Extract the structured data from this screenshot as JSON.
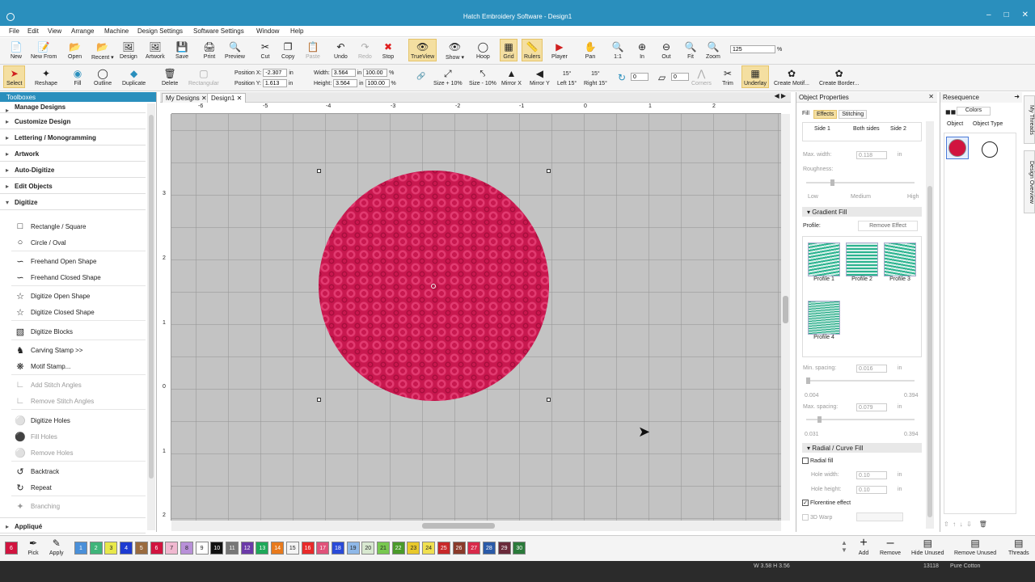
{
  "app_title": "Hatch Embroidery Software - Design1",
  "menu": [
    "File",
    "Edit",
    "View",
    "Arrange",
    "Machine",
    "Design Settings",
    "Software Settings",
    "Window",
    "Help"
  ],
  "toolbar1": [
    {
      "label": "New",
      "icon": "new-icon"
    },
    {
      "label": "New From",
      "icon": "new-from-icon"
    },
    {
      "label": "Open",
      "icon": "open-icon"
    },
    {
      "label": "Recent ▾",
      "icon": "recent-icon"
    },
    {
      "label": "Design",
      "icon": "design-icon"
    },
    {
      "label": "Artwork",
      "icon": "artwork-icon"
    },
    {
      "label": "Save",
      "icon": "save-icon"
    },
    {
      "label": "Print",
      "icon": "print-icon"
    },
    {
      "label": "Preview",
      "icon": "preview-icon"
    },
    {
      "label": "Cut",
      "icon": "cut-icon"
    },
    {
      "label": "Copy",
      "icon": "copy-icon"
    },
    {
      "label": "Paste",
      "icon": "paste-icon"
    },
    {
      "label": "Undo",
      "icon": "undo-icon"
    },
    {
      "label": "Redo",
      "icon": "redo-icon"
    },
    {
      "label": "Stop",
      "icon": "stop-icon"
    },
    {
      "label": "TrueView",
      "icon": "trueview-icon"
    },
    {
      "label": "Show ▾",
      "icon": "show-icon"
    },
    {
      "label": "Hoop",
      "icon": "hoop-icon"
    },
    {
      "label": "Grid",
      "icon": "grid-icon"
    },
    {
      "label": "Rulers",
      "icon": "rulers-icon"
    },
    {
      "label": "Player",
      "icon": "player-icon"
    },
    {
      "label": "Pan",
      "icon": "pan-icon"
    },
    {
      "label": "1:1",
      "icon": "zoom-1to1-icon"
    },
    {
      "label": "In",
      "icon": "zoom-in-icon"
    },
    {
      "label": "Out",
      "icon": "zoom-out-icon"
    },
    {
      "label": "Fit",
      "icon": "zoom-fit-icon"
    },
    {
      "label": "Zoom",
      "icon": "zoom-icon"
    }
  ],
  "zoom_value": "125",
  "zoom_unit": "%",
  "toolbar2": [
    {
      "label": "Select",
      "icon": "select-icon"
    },
    {
      "label": "Reshape",
      "icon": "reshape-icon"
    },
    {
      "label": "Fill",
      "icon": "fill-icon"
    },
    {
      "label": "Outline",
      "icon": "outline-icon"
    },
    {
      "label": "Duplicate",
      "icon": "duplicate-icon"
    },
    {
      "label": "Delete",
      "icon": "delete-icon"
    },
    {
      "label": "Rectangular",
      "icon": "rectangular-icon"
    }
  ],
  "position": {
    "x_label": "Position X:",
    "x_value": "-2.307",
    "y_label": "Position Y:",
    "y_value": "1.613",
    "unit": "in"
  },
  "size": {
    "w_label": "Width:",
    "w_value": "3.564",
    "h_label": "Height:",
    "h_value": "3.564",
    "unit": "in",
    "pct_w": "100.00",
    "pct_h": "100.00",
    "pct": "%"
  },
  "toolbar3": [
    {
      "label": "Size + 10%",
      "icon": "size-plus-icon"
    },
    {
      "label": "Size - 10%",
      "icon": "size-minus-icon"
    },
    {
      "label": "Mirror X",
      "icon": "mirror-x-icon"
    },
    {
      "label": "Mirror Y",
      "icon": "mirror-y-icon"
    },
    {
      "label": "Left 15°",
      "icon": "rotate-left-icon",
      "badge": "15°"
    },
    {
      "label": "Right 15°",
      "icon": "rotate-right-icon",
      "badge": "15°"
    }
  ],
  "rotate_value": "0",
  "slant_value": "0",
  "toolbar4": [
    {
      "label": "Corners",
      "icon": "corners-icon"
    },
    {
      "label": "Trim",
      "icon": "trim-icon"
    },
    {
      "label": "Underlay",
      "icon": "underlay-icon"
    },
    {
      "label": "Create Motif...",
      "icon": "create-motif-icon"
    },
    {
      "label": "Create Border...",
      "icon": "create-border-icon"
    }
  ],
  "toolboxes": {
    "title": "Toolboxes",
    "sections": [
      "Manage Designs",
      "Customize Design",
      "Lettering / Monogramming",
      "Artwork",
      "Auto-Digitize",
      "Edit Objects",
      "Digitize"
    ],
    "items": [
      {
        "label": "Rectangle / Square",
        "icon": "rectangle-icon"
      },
      {
        "label": "Circle / Oval",
        "icon": "circle-icon"
      },
      {
        "label": "Freehand Open Shape",
        "icon": "freehand-open-icon"
      },
      {
        "label": "Freehand Closed Shape",
        "icon": "freehand-closed-icon"
      },
      {
        "label": "Digitize Open Shape",
        "icon": "digitize-open-icon"
      },
      {
        "label": "Digitize Closed Shape",
        "icon": "digitize-closed-icon"
      },
      {
        "label": "Digitize Blocks",
        "icon": "digitize-blocks-icon"
      },
      {
        "label": "Carving Stamp >>",
        "icon": "carving-stamp-icon"
      },
      {
        "label": "Motif Stamp...",
        "icon": "motif-stamp-icon"
      },
      {
        "label": "Add Stitch Angles",
        "icon": "add-stitch-angles-icon"
      },
      {
        "label": "Remove Stitch Angles",
        "icon": "remove-stitch-angles-icon"
      },
      {
        "label": "Digitize Holes",
        "icon": "digitize-holes-icon"
      },
      {
        "label": "Fill Holes",
        "icon": "fill-holes-icon"
      },
      {
        "label": "Remove Holes",
        "icon": "remove-holes-icon"
      },
      {
        "label": "Backtrack",
        "icon": "backtrack-icon"
      },
      {
        "label": "Repeat",
        "icon": "repeat-icon"
      },
      {
        "label": "Branching",
        "icon": "branching-icon"
      }
    ],
    "footer_section": "Appliqué"
  },
  "doc_tabs": [
    "My Designs",
    "Design1"
  ],
  "ruler_h": [
    "-6",
    "-5",
    "-4",
    "-3",
    "-2",
    "-1",
    "0",
    "1",
    "2"
  ],
  "ruler_v": [
    "3",
    "2",
    "1",
    "0",
    "1",
    "2"
  ],
  "object_properties": {
    "title": "Object Properties",
    "tabs": [
      "Fill",
      "Effects",
      "Stitching"
    ],
    "sides": [
      "Side 1",
      "Both sides",
      "Side 2"
    ],
    "max_width_label": "Max. width:",
    "max_width_value": "0.118",
    "in": "in",
    "roughness_label": "Roughness:",
    "scale": [
      "Low",
      "Medium",
      "High"
    ],
    "gradient_title": "Gradient Fill",
    "profile_label": "Profile:",
    "remove_effect": "Remove Effect",
    "profiles": [
      "Profile 1",
      "Profile 2",
      "Profile 3",
      "Profile 4"
    ],
    "min_spacing_label": "Min. spacing:",
    "min_spacing_value": "0.016",
    "min_range": [
      "0.004",
      "0.394"
    ],
    "max_spacing_label": "Max. spacing:",
    "max_spacing_value": "0.079",
    "max_range": [
      "0.031",
      "0.394"
    ],
    "radial_title": "Radial / Curve Fill",
    "radial_fill": "Radial fill",
    "hole_width_label": "Hole width:",
    "hole_width_value": "0.10",
    "hole_height_label": "Hole height:",
    "hole_height_value": "0.10",
    "florentine": "Florentine effect",
    "warp": "3D Warp"
  },
  "resequence": {
    "title": "Resequence",
    "colors_tab": "Colors",
    "object_tab": "Object",
    "object_type_tab": "Object Type"
  },
  "side_tabs": [
    "My Threads",
    "Design Overview"
  ],
  "palette": [
    {
      "n": "1",
      "c": "#4a90d9"
    },
    {
      "n": "2",
      "c": "#3fb47a"
    },
    {
      "n": "3",
      "c": "#e8e84a"
    },
    {
      "n": "4",
      "c": "#1d3bd1"
    },
    {
      "n": "5",
      "c": "#9a6b3f"
    },
    {
      "n": "6",
      "c": "#d1143f"
    },
    {
      "n": "7",
      "c": "#f0b8d0"
    },
    {
      "n": "8",
      "c": "#b890d8"
    },
    {
      "n": "9",
      "c": "#ffffff"
    },
    {
      "n": "10",
      "c": "#111111"
    },
    {
      "n": "11",
      "c": "#777777"
    },
    {
      "n": "12",
      "c": "#6b3aa8"
    },
    {
      "n": "13",
      "c": "#1fa85a"
    },
    {
      "n": "14",
      "c": "#e87a1c"
    },
    {
      "n": "15",
      "c": "#f4f4f4"
    },
    {
      "n": "16",
      "c": "#e82a2a"
    },
    {
      "n": "17",
      "c": "#e0527a"
    },
    {
      "n": "18",
      "c": "#2a4ad8"
    },
    {
      "n": "19",
      "c": "#8fb8e8"
    },
    {
      "n": "20",
      "c": "#d8e8d0"
    },
    {
      "n": "21",
      "c": "#78c850"
    },
    {
      "n": "22",
      "c": "#4a9a2a"
    },
    {
      "n": "23",
      "c": "#e8c82a"
    },
    {
      "n": "24",
      "c": "#f0e050"
    },
    {
      "n": "25",
      "c": "#c8282a"
    },
    {
      "n": "26",
      "c": "#8a3a2a"
    },
    {
      "n": "27",
      "c": "#d82a4a"
    },
    {
      "n": "28",
      "c": "#2a5aa8"
    },
    {
      "n": "29",
      "c": "#6a2a3a"
    },
    {
      "n": "30",
      "c": "#2a7a3a"
    }
  ],
  "current_color": {
    "n": "6",
    "c": "#d1143f"
  },
  "colorbar_actions": [
    "Pick",
    "Apply"
  ],
  "thread_actions": [
    "Add",
    "Remove",
    "Hide Unused",
    "Remove Unused",
    "Threads"
  ],
  "status": {
    "dims": "W 3.58 H 3.56",
    "stitches": "13118",
    "thread": "Pure Cotton"
  },
  "colors": {
    "accent": "#2a8fbd",
    "fill": "#c8184f"
  }
}
